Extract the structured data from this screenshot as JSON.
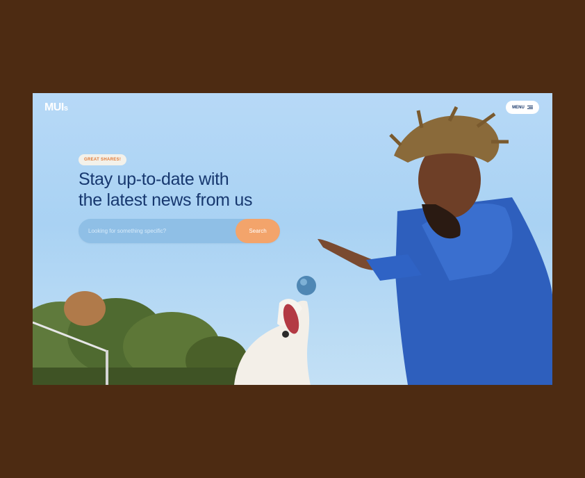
{
  "brand": {
    "logo_text": "MUI",
    "logo_suffix": "s"
  },
  "header": {
    "menu_label": "MENU"
  },
  "hero": {
    "badge": "GREAT SHARES!",
    "headline_line1": "Stay up-to-date with",
    "headline_line2": "the latest news from us"
  },
  "search": {
    "placeholder": "Looking for something specific?",
    "button_label": "Search"
  },
  "colors": {
    "page_background": "#4d2b12",
    "headline": "#17386f",
    "badge_text": "#e07a38",
    "search_button": "#f3a46b",
    "search_field": "#8fbfe6"
  }
}
